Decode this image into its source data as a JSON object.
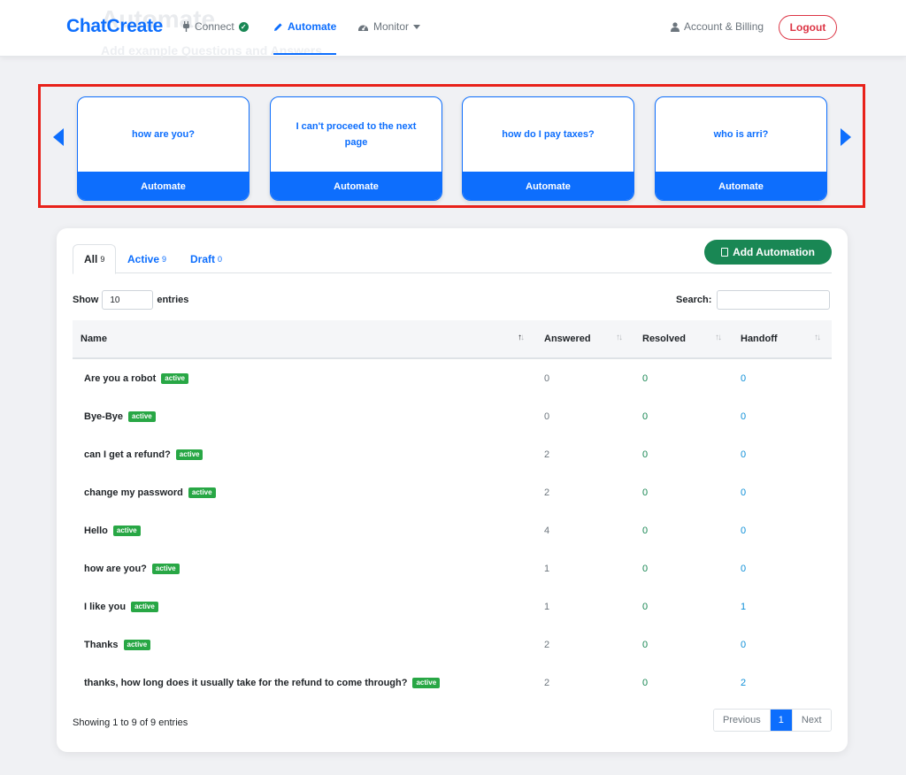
{
  "header": {
    "brand": "ChatCreate",
    "ghost_title": "Automate",
    "ghost_subtitle": "Add example Questions and Answers",
    "nav": [
      {
        "label": "Connect",
        "icon": "plug-icon",
        "status_icon": "check-circle-icon"
      },
      {
        "label": "Automate",
        "icon": "pencil-icon"
      },
      {
        "label": "Monitor",
        "icon": "dashboard-icon"
      }
    ],
    "account_label": "Account & Billing",
    "logout_label": "Logout"
  },
  "carousel": {
    "cards": [
      {
        "question": "how are you?",
        "button": "Automate"
      },
      {
        "question": "I can't proceed to the next page",
        "button": "Automate"
      },
      {
        "question": "how do I pay taxes?",
        "button": "Automate"
      },
      {
        "question": "who is arri?",
        "button": "Automate"
      }
    ]
  },
  "tabs": [
    {
      "label": "All",
      "count": "9"
    },
    {
      "label": "Active",
      "count": "9"
    },
    {
      "label": "Draft",
      "count": "0"
    }
  ],
  "add_button": "Add Automation",
  "show": {
    "prefix": "Show",
    "value": "10",
    "suffix": "entries"
  },
  "search_label": "Search:",
  "columns": [
    "Name",
    "Answered",
    "Resolved",
    "Handoff"
  ],
  "rows": [
    {
      "name": "Are you a robot",
      "status": "active",
      "answered": "0",
      "resolved": "0",
      "handoff": "0"
    },
    {
      "name": "Bye-Bye",
      "status": "active",
      "answered": "0",
      "resolved": "0",
      "handoff": "0"
    },
    {
      "name": "can I get a refund?",
      "status": "active",
      "answered": "2",
      "resolved": "0",
      "handoff": "0"
    },
    {
      "name": "change my password",
      "status": "active",
      "answered": "2",
      "resolved": "0",
      "handoff": "0"
    },
    {
      "name": "Hello",
      "status": "active",
      "answered": "4",
      "resolved": "0",
      "handoff": "0"
    },
    {
      "name": "how are you?",
      "status": "active",
      "answered": "1",
      "resolved": "0",
      "handoff": "0"
    },
    {
      "name": "I like you",
      "status": "active",
      "answered": "1",
      "resolved": "0",
      "handoff": "1"
    },
    {
      "name": "Thanks",
      "status": "active",
      "answered": "2",
      "resolved": "0",
      "handoff": "0"
    },
    {
      "name": "thanks, how long does it usually take for the refund to come through?",
      "status": "active",
      "answered": "2",
      "resolved": "0",
      "handoff": "2"
    }
  ],
  "footer": {
    "info": "Showing 1 to 9 of 9 entries",
    "prev": "Previous",
    "current": "1",
    "next": "Next"
  },
  "colors": {
    "primary": "#0d6efd",
    "success": "#198754",
    "danger": "#dc3545",
    "highlight": "#e8211a"
  }
}
